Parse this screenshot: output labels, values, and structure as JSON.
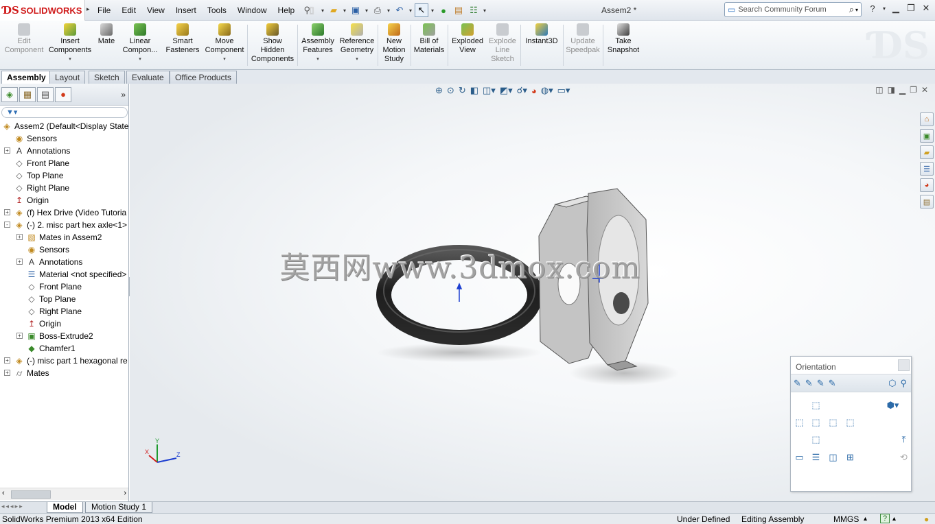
{
  "app": {
    "logo_prefix": "ƊS",
    "logo_text": "SOLIDWORKS",
    "document_title": "Assem2 *"
  },
  "menu": [
    "File",
    "Edit",
    "View",
    "Insert",
    "Tools",
    "Window",
    "Help"
  ],
  "search": {
    "placeholder": "Search Community Forum"
  },
  "command_manager": [
    {
      "label": "Edit\nComponent",
      "disabled": true
    },
    {
      "label": "Insert\nComponents",
      "dropdown": true
    },
    {
      "label": "Mate"
    },
    {
      "label": "Linear\nCompon...",
      "dropdown": true
    },
    {
      "label": "Smart\nFasteners"
    },
    {
      "label": "Move\nComponent",
      "dropdown": true
    },
    {
      "label": "Show\nHidden\nComponents"
    },
    {
      "label": "Assembly\nFeatures",
      "dropdown": true
    },
    {
      "label": "Reference\nGeometry",
      "dropdown": true
    },
    {
      "label": "New\nMotion\nStudy"
    },
    {
      "label": "Bill of\nMaterials"
    },
    {
      "label": "Exploded\nView"
    },
    {
      "label": "Explode\nLine\nSketch",
      "disabled": true
    },
    {
      "label": "Instant3D"
    },
    {
      "label": "Update\nSpeedpak",
      "disabled": true
    },
    {
      "label": "Take\nSnapshot"
    }
  ],
  "cm_tabs": [
    "Assembly",
    "Layout",
    "Sketch",
    "Evaluate",
    "Office Products"
  ],
  "tree": [
    {
      "label": "Assem2  (Default<Display State",
      "icon": "assembly-icon",
      "level": 0,
      "expand": ""
    },
    {
      "label": "Sensors",
      "icon": "sensors-icon",
      "level": 1,
      "expand": ""
    },
    {
      "label": "Annotations",
      "icon": "annotations-icon",
      "level": 1,
      "expand": "+"
    },
    {
      "label": "Front Plane",
      "icon": "plane-icon",
      "level": 1,
      "expand": ""
    },
    {
      "label": "Top Plane",
      "icon": "plane-icon",
      "level": 1,
      "expand": ""
    },
    {
      "label": "Right Plane",
      "icon": "plane-icon",
      "level": 1,
      "expand": ""
    },
    {
      "label": "Origin",
      "icon": "origin-icon",
      "level": 1,
      "expand": ""
    },
    {
      "label": "(f) Hex Drive (Video Tutoria",
      "icon": "part-icon",
      "level": 1,
      "expand": "+"
    },
    {
      "label": "(-) 2. misc part hex axle<1>",
      "icon": "part-icon",
      "level": 1,
      "expand": "-"
    },
    {
      "label": "Mates in Assem2",
      "icon": "mates-folder-icon",
      "level": 2,
      "expand": "+"
    },
    {
      "label": "Sensors",
      "icon": "sensors-icon",
      "level": 2,
      "expand": ""
    },
    {
      "label": "Annotations",
      "icon": "annotations-icon",
      "level": 2,
      "expand": "+"
    },
    {
      "label": "Material <not specified>",
      "icon": "material-icon",
      "level": 2,
      "expand": ""
    },
    {
      "label": "Front Plane",
      "icon": "plane-icon",
      "level": 2,
      "expand": ""
    },
    {
      "label": "Top Plane",
      "icon": "plane-icon",
      "level": 2,
      "expand": ""
    },
    {
      "label": "Right Plane",
      "icon": "plane-icon",
      "level": 2,
      "expand": ""
    },
    {
      "label": "Origin",
      "icon": "origin-icon",
      "level": 2,
      "expand": ""
    },
    {
      "label": "Boss-Extrude2",
      "icon": "extrude-icon",
      "level": 2,
      "expand": "+"
    },
    {
      "label": "Chamfer1",
      "icon": "chamfer-icon",
      "level": 2,
      "expand": ""
    },
    {
      "label": "(-) misc part 1 hexagonal re",
      "icon": "part-icon",
      "level": 1,
      "expand": "+"
    },
    {
      "label": "Mates",
      "icon": "mates-icon",
      "level": 1,
      "expand": "+"
    }
  ],
  "watermark": "莫西网www.3dmox.com",
  "triad": {
    "x": "X",
    "y": "Y",
    "z": "Z"
  },
  "orientation": {
    "title": "Orientation"
  },
  "bottom_tabs": [
    "Model",
    "Motion Study 1"
  ],
  "status": {
    "edition": "SolidWorks Premium 2013 x64 Edition",
    "defined": "Under Defined",
    "mode": "Editing Assembly",
    "units": "MMGS",
    "units_arrow": "▴"
  },
  "colors": {
    "accent": "#d01c1c",
    "axis_blue": "#1d3fd0"
  }
}
